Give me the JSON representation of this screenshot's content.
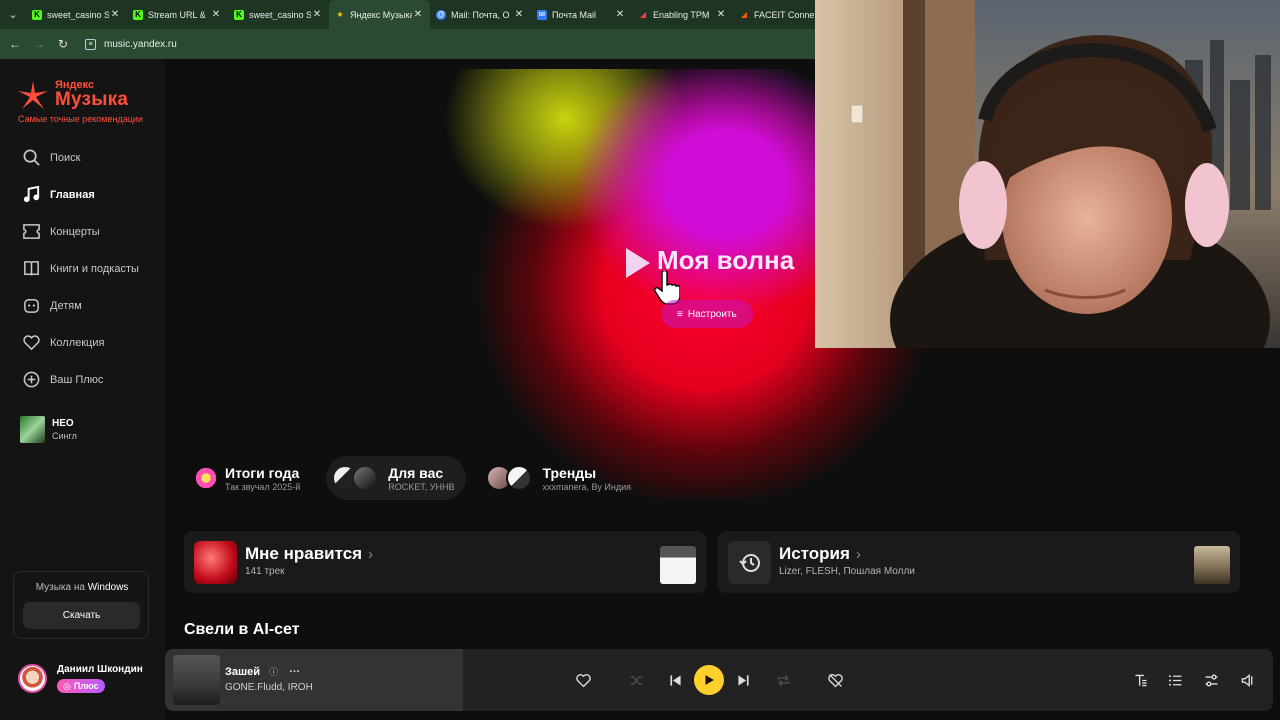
{
  "browser": {
    "tabs": [
      {
        "title": "sweet_casino S",
        "favicon": "K",
        "color": "#53fc18",
        "active": false
      },
      {
        "title": "Stream URL &",
        "favicon": "K",
        "color": "#53fc18",
        "active": false
      },
      {
        "title": "sweet_casino S",
        "favicon": "K",
        "color": "#53fc18",
        "active": false
      },
      {
        "title": "Яндекс Музыка",
        "favicon": "★",
        "color": "#ffcc00",
        "active": true
      },
      {
        "title": "Mail: Почта, О",
        "favicon": "@",
        "color": "#2f7cf6",
        "active": false
      },
      {
        "title": "Почта Mail",
        "favicon": "✉",
        "color": "#2f7cf6",
        "active": false
      },
      {
        "title": "Enabling TPM",
        "favicon": "◢",
        "color": "#ff3b3b",
        "active": false
      },
      {
        "title": "FACEIT Conne",
        "favicon": "◢",
        "color": "#ff5500",
        "active": false
      }
    ],
    "url": "music.yandex.ru"
  },
  "sidebar": {
    "logo_top": "Яндекс",
    "logo_main": "Музыка",
    "logo_sub": "Самые точные рекомендации",
    "nav": [
      {
        "label": "Поиск",
        "icon": "search-icon",
        "active": false
      },
      {
        "label": "Главная",
        "icon": "music-note-icon",
        "active": true
      },
      {
        "label": "Концерты",
        "icon": "ticket-icon",
        "active": false
      },
      {
        "label": "Книги и подкасты",
        "icon": "book-icon",
        "active": false
      },
      {
        "label": "Детям",
        "icon": "kids-icon",
        "active": false
      },
      {
        "label": "Коллекция",
        "icon": "heart-icon",
        "active": false
      },
      {
        "label": "Ваш Плюс",
        "icon": "plus-icon",
        "active": false
      }
    ],
    "release": {
      "title": "НЕО",
      "subtitle": "Сингл"
    },
    "promo": {
      "text_prefix": "Музыка на ",
      "text_platform": "Windows",
      "button": "Скачать"
    },
    "user": {
      "name": "Даниил Шкондин",
      "badge": "Плюс"
    }
  },
  "main": {
    "wave": {
      "title": "Моя волна",
      "tune_label": "Настроить"
    },
    "chips": [
      {
        "title": "Итоги года",
        "subtitle": "Так звучал 2025-й",
        "selected": false
      },
      {
        "title": "Для вас",
        "subtitle": "ROCKET, УННВ",
        "selected": true
      },
      {
        "title": "Тренды",
        "subtitle": "xxxmanera, Ву Индия",
        "selected": false
      }
    ],
    "cards": [
      {
        "title": "Мне нравится",
        "subtitle": "141 трек"
      },
      {
        "title": "История",
        "subtitle": "Lizer, FLESH, Пошлая Молли"
      }
    ],
    "section_title": "Свели в AI-сет"
  },
  "player": {
    "track": "Зашей",
    "artists": "GONE.Fludd, IROH"
  },
  "colors": {
    "accent_red": "#ff4f38",
    "play_yellow": "#ffcf2c",
    "wave_magenta": "#d10dd8",
    "wave_red": "#ff0030"
  }
}
